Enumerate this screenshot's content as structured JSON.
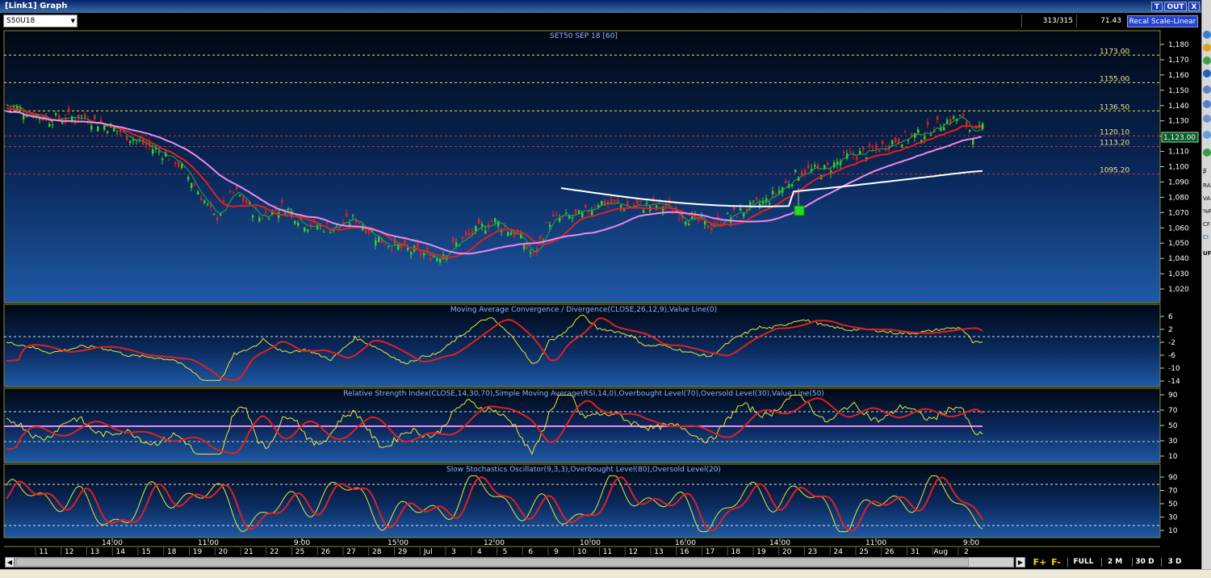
{
  "window": {
    "title": "[Link1] Graph",
    "btn_t": "T",
    "btn_out": "OUT",
    "btn_close": "X"
  },
  "toolbar": {
    "symbol": "S50U18",
    "bars_count": "313/315",
    "last_value": "71.43",
    "recal_label": "Recal Scale-Linear"
  },
  "price_pane": {
    "title": "SET50 SEP 18  [60]",
    "y_ticks": [
      "1,180",
      "1,170",
      "1,160",
      "1,150",
      "1,140",
      "1,130",
      "1,120",
      "1,110",
      "1,100",
      "1,090",
      "1,080",
      "1,070",
      "1,060",
      "1,050",
      "1,040",
      "1,030",
      "1,020"
    ],
    "current_price": "1,123.00",
    "levels": [
      {
        "label": "1173.00",
        "value": 1173.0,
        "color": "#e8e85a"
      },
      {
        "label": "1155.00",
        "value": 1155.0,
        "color": "#e8e85a"
      },
      {
        "label": "1136.50",
        "value": 1136.5,
        "color": "#e8e85a"
      },
      {
        "label": "1120.10",
        "value": 1120.1,
        "color": "#d03030"
      },
      {
        "label": "1113.20",
        "value": 1113.2,
        "color": "#d03030"
      },
      {
        "label": "1095.20",
        "value": 1095.2,
        "color": "#d03030"
      }
    ],
    "signal_marker": "buy-signal"
  },
  "macd_pane": {
    "title": "Moving Average Convergence / Divergence(CLOSE,26,12,9),Value Line(0)",
    "y_ticks": [
      "6",
      "2",
      "-2",
      "-6",
      "-10",
      "-14"
    ]
  },
  "rsi_pane": {
    "title": "Relative Strength Index(CLOSE,14,30,70),Simple Moving Average(RSI,14,0),Overbought Level(70),Oversold Level(30),Value Line(50)",
    "y_ticks": [
      "90",
      "70",
      "50",
      "30",
      "10"
    ]
  },
  "stoch_pane": {
    "title": "Slow Stochastics Oscillator(9,3,3),Overbought Level(80),Oversold Level(20)",
    "y_ticks": [
      "90",
      "70",
      "50",
      "30",
      "10"
    ]
  },
  "x_axis": {
    "time_labels": [
      "14:00",
      "11:00",
      "9:00",
      "15:00",
      "12:00",
      "10:00",
      "16:00",
      "14:00",
      "11:00",
      "9:00"
    ],
    "date_labels": [
      "11",
      "12",
      "13",
      "14",
      "15",
      "18",
      "19",
      "20",
      "21",
      "22",
      "25",
      "26",
      "27",
      "28",
      "29",
      "Jul",
      "3",
      "4",
      "5",
      "6",
      "9",
      "10",
      "11",
      "12",
      "13",
      "16",
      "17",
      "18",
      "19",
      "20",
      "23",
      "24",
      "25",
      "26",
      "31",
      "Aug",
      "2"
    ]
  },
  "bottom_bar": {
    "f_plus": "F+",
    "f_minus": "F-",
    "full": "FULL",
    "two_m": "2 M",
    "thirty_d": "30 D",
    "three_d": "3 D"
  },
  "side_panel": {
    "labels": [
      "β",
      "RA",
      "VA",
      "%F",
      "CF",
      "CI",
      "UF"
    ]
  },
  "colors": {
    "price_up": "#44cc22",
    "price_down": "#e02020",
    "ma_fast": "#22aa44",
    "ma_mid": "#e02020",
    "ma_slow": "#ee88ee",
    "ma_long": "#ffffff",
    "indicator_main": "#e8e830",
    "indicator_signal": "#e02020",
    "level_line": "#e8e85a"
  }
}
